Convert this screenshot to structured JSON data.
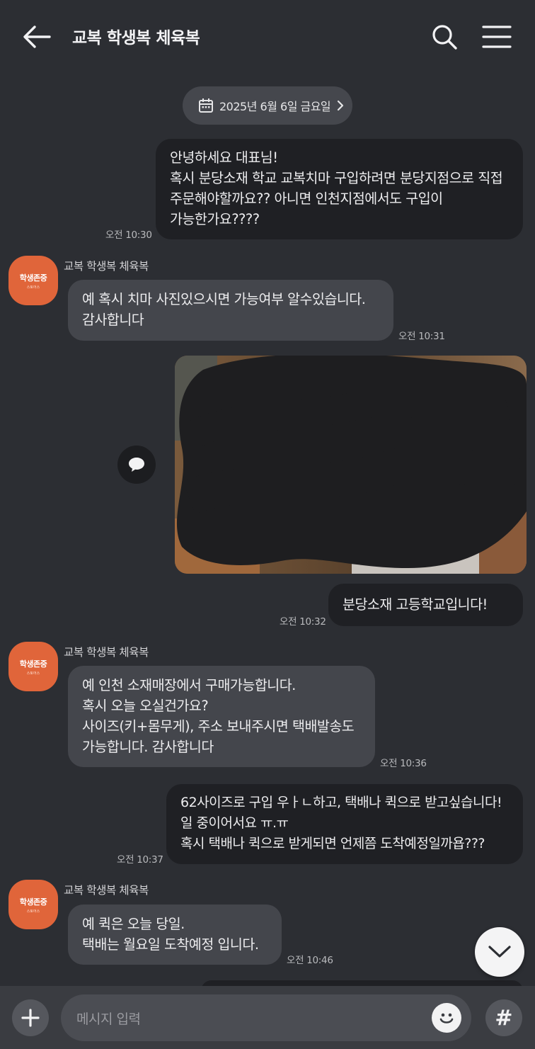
{
  "header": {
    "back_icon": "arrow-left-icon",
    "title": "교복 학생복 체육복",
    "search_icon": "search-icon",
    "menu_icon": "hamburger-menu-icon"
  },
  "date_pill": {
    "icon": "calendar-icon",
    "text": "2025년 6월 6일 금요일",
    "chevron": "chevron-right-icon"
  },
  "avatar": {
    "line1": "학생존중",
    "line2": "스토어스",
    "color": "#e0653a"
  },
  "messages": [
    {
      "side": "me",
      "text": "안녕하세요 대표님!\n혹시 분당소재 학교 교복치마 구입하려면 분당지점으로 직접\n주문해야할까요?? 아니면 인천지점에서도 구입이\n가능한가요????",
      "time": "오전 10:30"
    },
    {
      "side": "them",
      "sender": "교복 학생복 체육복",
      "text": "예 혹시 치마 사진있으시면 가능여부 알수있습니다.\n감사합니다",
      "time": "오전 10:31"
    },
    {
      "side": "me",
      "type": "image",
      "note": "redacted-photo"
    },
    {
      "side": "me",
      "text": "분당소재       고등학교입니다!",
      "time": "오전 10:32"
    },
    {
      "side": "them",
      "sender": "교복 학생복 체육복",
      "text": "예 인천 소재매장에서 구매가능합니다.\n혹시 오늘 오실건가요?\n사이즈(키+몸무게), 주소 보내주시면 택배발송도\n가능합니다. 감사합니다",
      "time": "오전 10:36"
    },
    {
      "side": "me",
      "text": "62사이즈로 구입 우ㅏㄴ하고, 택배나 퀵으로 받고싶습니다!\n일 중이어서요 ㅠ.ㅠ\n혹시 택배나 퀵으로 받게되면 언제쯤 도착예정일까욥???",
      "time": "오전 10:37"
    },
    {
      "side": "them",
      "sender": "교복 학생복 체육복",
      "text": "예 퀵은 오늘 당일.\n택배는 월요일 도착예정 입니다.",
      "time": "오전 10:46"
    }
  ],
  "reply_icon": "speech-bubble-icon",
  "scroll_down_icon": "chevron-down-icon",
  "composer": {
    "plus_icon": "plus-icon",
    "placeholder": "메시지 입력",
    "emoji_icon": "smiley-icon",
    "hash_icon": "hash-icon",
    "hash_label": "#"
  },
  "colors": {
    "background": "#2c2e33",
    "my_bubble": "#1f2024",
    "their_bubble": "#44464c",
    "bottom_bar": "#3a3c41"
  }
}
